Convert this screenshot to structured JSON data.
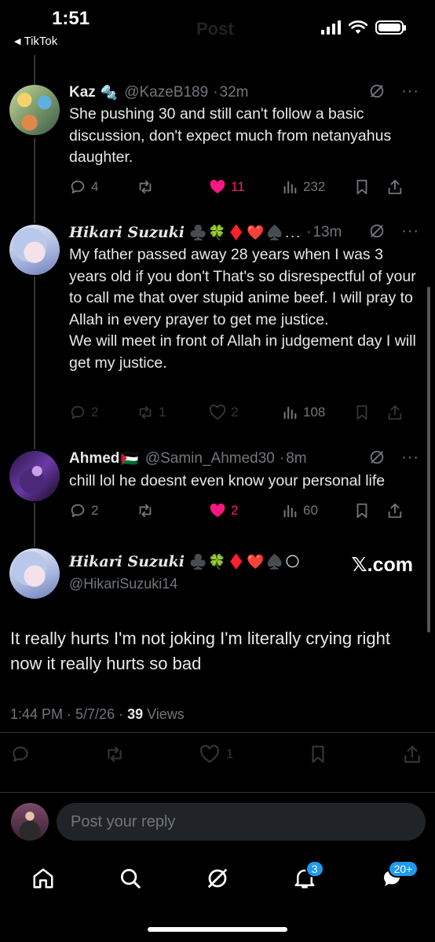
{
  "status_bar": {
    "time": "1:51",
    "back_app": "TikTok",
    "faded_title": "Post"
  },
  "replies": [
    {
      "name": "Kaz",
      "name_emoji": "🔩",
      "handle": "@KazeB189",
      "time": "32m",
      "text": "She pushing 30 and still can't follow a basic discussion, don't expect much from netanyahus daughter.",
      "replies": "4",
      "reposts": "",
      "likes": "11",
      "views": "232",
      "liked": true
    },
    {
      "name": "Hikari Suzuki",
      "name_emoji": "♣️🍀♦️❤️♠️...",
      "handle": "",
      "time": "13m",
      "text_lines": [
        "My father passed away 28 years when I was 3 years old if you don't That's so disrespectful of your to call me that over stupid anime beef. I will pray to Allah in every prayer to get me justice.",
        "We will meet in front of Allah in judgement day I will get my justice."
      ],
      "replies": "2",
      "reposts": "1",
      "likes": "2",
      "views": "108",
      "liked": false
    },
    {
      "name": "Ahmed",
      "name_emoji": "🇵🇸",
      "handle": "@Samin_Ahmed30",
      "time": "8m",
      "text": "chill lol he doesnt even know your personal life",
      "replies": "2",
      "reposts": "",
      "likes": "2",
      "views": "60",
      "liked": true
    }
  ],
  "main_post": {
    "name": "Hikari Suzuki",
    "name_emoji": "♣️🍀♦️❤️♠️🌕",
    "handle": "@HikariSuzuki14",
    "watermark": "𝕏.com",
    "text": "It really hurts I'm not joking I'm literally crying right now it really hurts so bad",
    "timestamp": "1:44 PM · 5/7/26 · ",
    "views_count": "39",
    "views_label": " Views",
    "likes": "1"
  },
  "reply_bar": {
    "placeholder": "Post your reply"
  },
  "nav": {
    "notifications_badge": "3",
    "messages_badge": "20+"
  },
  "colors": {
    "background": "#000000",
    "text": "#e7e9ea",
    "muted": "#71767b",
    "like": "#f91880",
    "accent": "#1d9bf0"
  }
}
